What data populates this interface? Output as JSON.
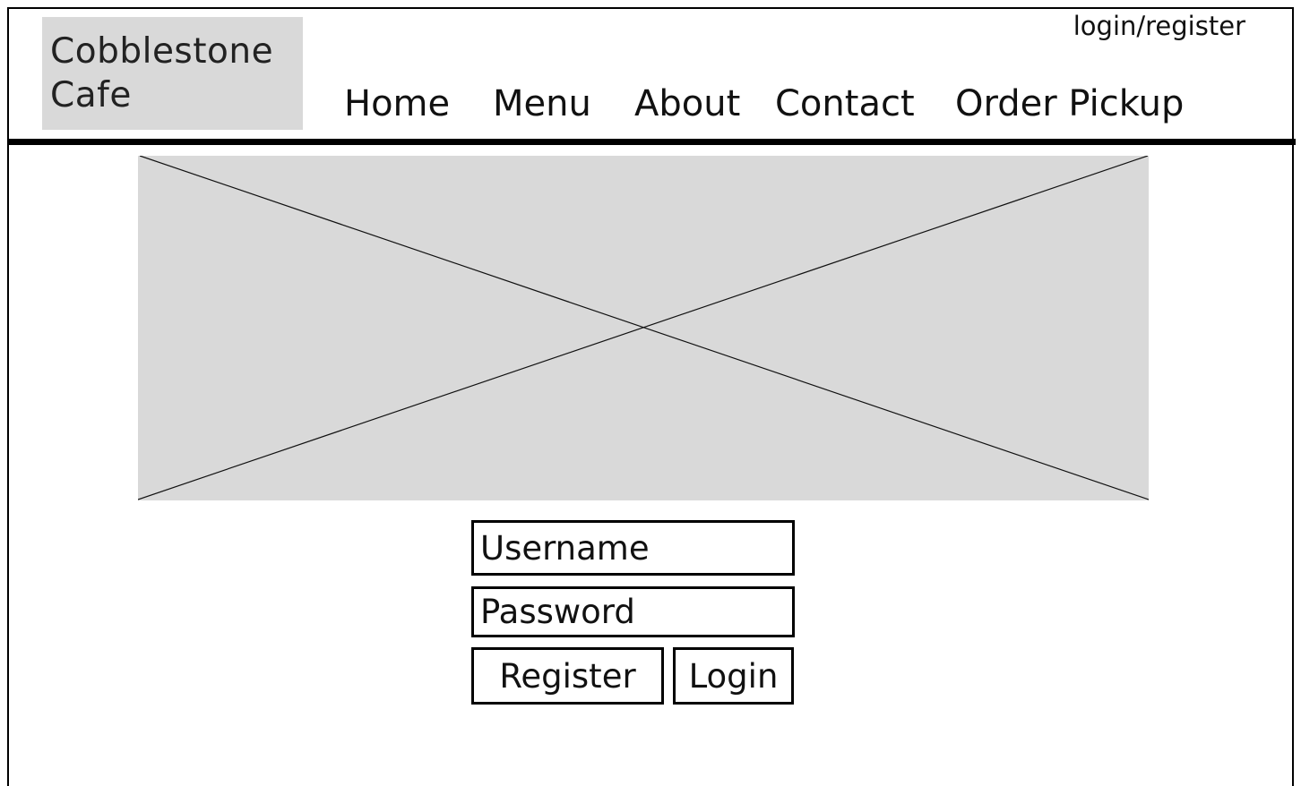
{
  "header": {
    "logo_line1": "Cobblestone",
    "logo_line2": "Cafe",
    "auth_link": "login/register"
  },
  "nav": {
    "items": [
      {
        "label": "Home"
      },
      {
        "label": "Menu"
      },
      {
        "label": "About"
      },
      {
        "label": "Contact"
      },
      {
        "label": "Order Pickup"
      }
    ]
  },
  "hero": {
    "placeholder_icon": "image-placeholder-icon"
  },
  "login_form": {
    "username_placeholder": "Username",
    "password_placeholder": "Password",
    "register_label": "Register",
    "login_label": "Login"
  },
  "colors": {
    "placeholder_fill": "#d9d9d9",
    "border": "#000000",
    "background": "#ffffff"
  }
}
